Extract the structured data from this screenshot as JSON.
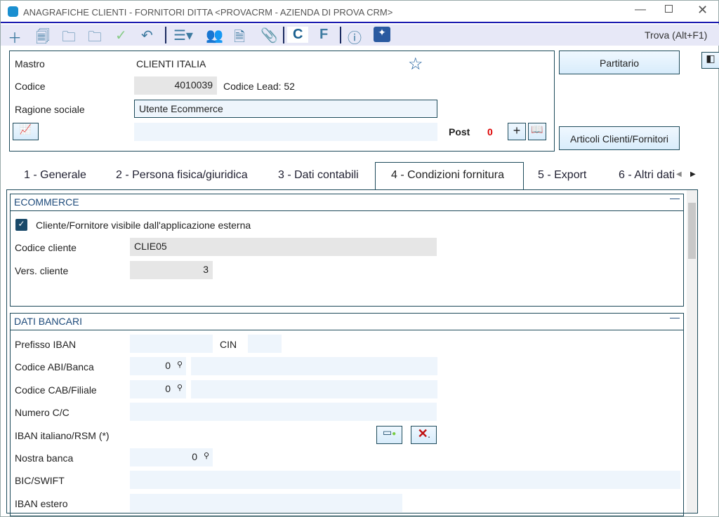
{
  "window": {
    "title": "ANAGRAFICHE CLIENTI - FORNITORI DITTA <PROVACRM - AZIENDA DI PROVA CRM>",
    "search": "Trova (Alt+F1)"
  },
  "toolbar": {
    "c": "C",
    "f": "F"
  },
  "header": {
    "mastro_label": "Mastro",
    "mastro": "CLIENTI ITALIA",
    "codice_label": "Codice",
    "codice": "4010039",
    "lead": "Codice Lead: 52",
    "ragione_label": "Ragione sociale",
    "ragione": "Utente Ecommerce",
    "post_label": "Post",
    "post": "0",
    "partitario": "Partitario",
    "articoli": "Articoli Clienti/Fornitori"
  },
  "tabs": [
    "1 - Generale",
    "2 - Persona fisica/giuridica",
    "3 - Dati contabili",
    "4 - Condizioni fornitura",
    "5 - Export",
    "6 - Altri dati"
  ],
  "ecommerce": {
    "title": "ECOMMERCE",
    "checkbox": "Cliente/Fornitore visibile dall'applicazione esterna",
    "checked": true,
    "codice_label": "Codice cliente",
    "codice": "CLIE05",
    "vers_label": "Vers. cliente",
    "vers": "3"
  },
  "bancari": {
    "title": "DATI BANCARI",
    "iban_label": "Prefisso IBAN",
    "cin_label": "CIN",
    "abi_label": "Codice ABI/Banca",
    "abi": "0",
    "cab_label": "Codice CAB/Filiale",
    "cab": "0",
    "cc_label": "Numero C/C",
    "iban_it_label": "IBAN italiano/RSM (*)",
    "nostra_label": "Nostra banca",
    "nostra": "0",
    "bic_label": "BIC/SWIFT",
    "iban_estero_label": "IBAN estero"
  }
}
